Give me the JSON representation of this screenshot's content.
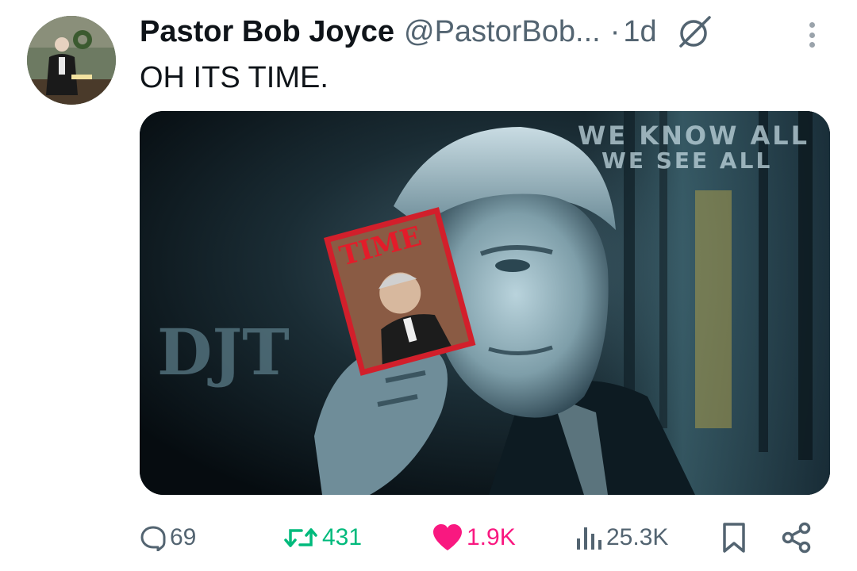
{
  "author": {
    "display_name": "Pastor Bob Joyce",
    "handle": "@PastorBob...",
    "separator": "·",
    "time_ago": "1d"
  },
  "tweet": {
    "text": "OH ITS TIME."
  },
  "media": {
    "overlay_line1": "WE KNOW ALL",
    "overlay_line2": "WE SEE ALL",
    "monogram": "DJT",
    "magazine_title": "TIME"
  },
  "actions": {
    "replies": "69",
    "reposts": "431",
    "likes": "1.9K",
    "views": "25.3K"
  },
  "colors": {
    "text_primary": "#0f1419",
    "text_secondary": "#536471",
    "repost_active": "#00ba7c",
    "like_active": "#f91880"
  },
  "icons": {
    "reply": "reply-icon",
    "repost": "repost-icon",
    "like": "heart-icon",
    "views": "views-icon",
    "bookmark": "bookmark-icon",
    "share": "share-icon",
    "grok": "grok-icon",
    "more": "more-icon"
  }
}
